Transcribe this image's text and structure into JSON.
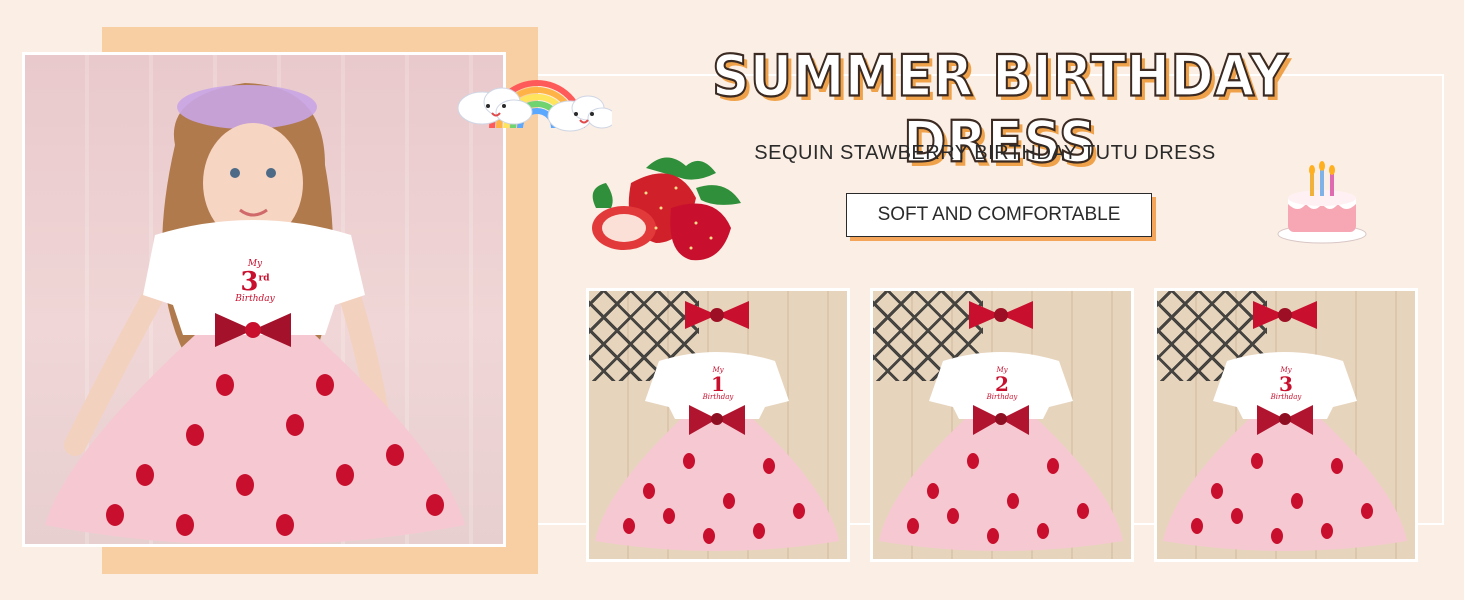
{
  "banner": {
    "title": "SUMMER BIRTHDAY DRESS",
    "subtitle": "SEQUIN STAWBERRY BIRTHDAY TUTU DRESS",
    "feature_badge": "SOFT AND COMFORTABLE"
  },
  "hero": {
    "shirt_text_top": "My",
    "shirt_number": "3",
    "shirt_suffix": "rd",
    "shirt_text_bottom": "Birthday"
  },
  "products": [
    {
      "shirt_text_top": "My",
      "shirt_number": "1",
      "shirt_text_bottom": "Birthday"
    },
    {
      "shirt_text_top": "My",
      "shirt_number": "2",
      "shirt_text_bottom": "Birthday"
    },
    {
      "shirt_text_top": "My",
      "shirt_number": "3",
      "shirt_text_bottom": "Birthday"
    }
  ],
  "colors": {
    "accent_orange": "#f4a55a",
    "peach_block": "#f8cfa3",
    "background": "#fbeee4",
    "strawberry_red": "#c8102e",
    "tutu_pink": "#f6c8d2"
  },
  "icons": [
    "rainbow-cloud-icon",
    "strawberry-icon",
    "birthday-cake-icon",
    "hair-bow-icon"
  ]
}
